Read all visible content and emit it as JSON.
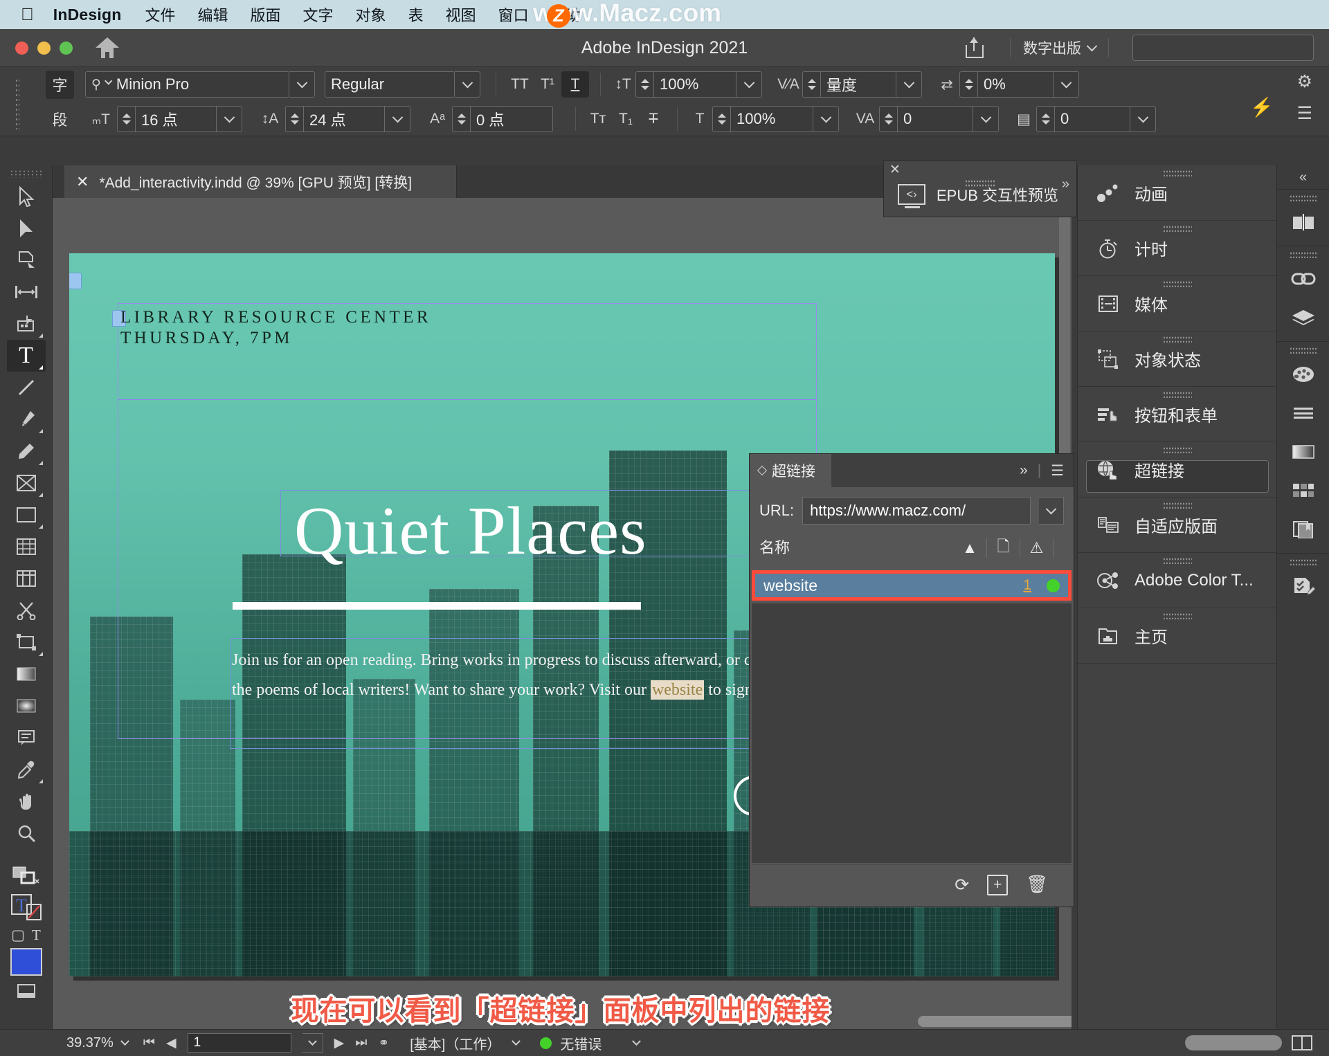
{
  "menubar": {
    "apple_icon": "apple-icon",
    "app_name": "InDesign",
    "items": [
      "文件",
      "编辑",
      "版面",
      "文字",
      "对象",
      "表",
      "视图",
      "窗口",
      "帮助"
    ],
    "watermark": "www.Macz.com",
    "watermark_badge": "Z"
  },
  "titlebar": {
    "title": "Adobe InDesign 2021",
    "home_icon": "home-icon",
    "share_icon": "share-icon",
    "publish_label": "数字出版",
    "search_placeholder": ""
  },
  "control_bar": {
    "char_mode_label": "字",
    "para_mode_label": "段",
    "font_family": "Minion Pro",
    "font_style": "Regular",
    "font_size": "16 点",
    "leading": "24 点",
    "baseline_shift": "0 点",
    "vertical_scale": "100%",
    "horizontal_scale": "100%",
    "kerning": "量度",
    "tracking": "0",
    "skew": "0%",
    "language_right": "0",
    "buttons": {
      "all_caps": "TT",
      "superscript": "T¹",
      "underline": "T",
      "small_caps": "Tᴛ",
      "subscript": "T₁",
      "strikethrough": "T"
    },
    "gear_icon": "gear-icon",
    "menu_icon": "hamburger-icon",
    "bolt_icon": "lightning-icon"
  },
  "toolbar": {
    "tools": [
      {
        "name": "selection-tool",
        "glyph": "▷"
      },
      {
        "name": "direct-selection-tool",
        "glyph": "◥"
      },
      {
        "name": "page-tool",
        "glyph": "page"
      },
      {
        "name": "gap-tool",
        "glyph": "|↔|"
      },
      {
        "name": "content-collector-tool",
        "glyph": "collect"
      },
      {
        "name": "type-tool",
        "glyph": "T",
        "selected": true
      },
      {
        "name": "line-tool",
        "glyph": "/"
      },
      {
        "name": "pen-tool",
        "glyph": "pen"
      },
      {
        "name": "pencil-tool",
        "glyph": "pencil"
      },
      {
        "name": "frame-tool",
        "glyph": "⊠"
      },
      {
        "name": "rectangle-tool",
        "glyph": "▭"
      },
      {
        "name": "free-transform-tool",
        "glyph": "grid"
      },
      {
        "name": "column-tool",
        "glyph": "cols"
      },
      {
        "name": "scissors-tool",
        "glyph": "✂"
      },
      {
        "name": "transform-tool",
        "glyph": "transform"
      },
      {
        "name": "gradient-swatch-tool",
        "glyph": "grad"
      },
      {
        "name": "gradient-feather-tool",
        "glyph": "feather"
      },
      {
        "name": "note-tool",
        "glyph": "note"
      },
      {
        "name": "eyedropper-tool",
        "glyph": "dropper"
      },
      {
        "name": "hand-tool",
        "glyph": "✋"
      },
      {
        "name": "zoom-tool",
        "glyph": "🔍"
      }
    ]
  },
  "document_tab": {
    "close_icon": "close-icon",
    "label": "*Add_interactivity.indd @ 39% [GPU 预览] [转换]"
  },
  "canvas": {
    "headline_line1": "LIBRARY RESOURCE CENTER",
    "headline_line2": "THURSDAY, 7PM",
    "big_title": "Quiet Places",
    "body_line1": "Join us for an open reading. Bring works in progress to discuss afterward, or co",
    "body_line2_a": "the poems of local writers! Want to share your work? Visit our ",
    "body_link": "website",
    "body_line2_b": " to sign u"
  },
  "epub_panel": {
    "close_icon": "close-icon",
    "icon": "code-monitor-icon",
    "label": "EPUB 交互性预览",
    "expand_icon": "double-chevron-right-icon"
  },
  "hyperlinks_panel": {
    "tab_label": "超链接",
    "expand_icon": "double-chevron-right-icon",
    "menu_icon": "panel-menu-icon",
    "url_label": "URL:",
    "url_value": "https://www.macz.com/",
    "column_name": "名称",
    "sort_icon": "sort-ascending-icon",
    "page_col_icon": "document-icon",
    "status_col_icon": "warning-icon",
    "rows": [
      {
        "name": "website",
        "page": "1",
        "status_color": "#44d22a"
      }
    ],
    "footer": {
      "refresh_icon": "refresh-icon",
      "new_icon": "new-hyperlink-icon",
      "delete_icon": "trash-icon"
    }
  },
  "right_panel": {
    "items": [
      {
        "label": "动画",
        "icon": "animation-icon",
        "selected": false
      },
      {
        "label": "计时",
        "icon": "timing-stopwatch-icon",
        "selected": false
      },
      {
        "label": "媒体",
        "icon": "media-film-icon",
        "selected": false
      },
      {
        "label": "对象状态",
        "icon": "object-states-icon",
        "selected": false
      },
      {
        "label": "按钮和表单",
        "icon": "buttons-forms-icon",
        "selected": false
      },
      {
        "label": "超链接",
        "icon": "hyperlinks-globe-icon",
        "selected": true
      },
      {
        "label": "自适应版面",
        "icon": "liquid-layout-icon",
        "selected": false
      },
      {
        "label": "Adobe Color T...",
        "icon": "adobe-color-themes-icon",
        "selected": false
      },
      {
        "label": "主页",
        "icon": "master-pages-icon",
        "selected": false
      }
    ]
  },
  "icon_dock": {
    "collapse_icon": "double-chevron-left-icon",
    "groups": [
      [
        "pages-spread-icon"
      ],
      [
        "links-chain-icon",
        "layers-icon"
      ],
      [
        "color-palette-icon",
        "stroke-lines-icon",
        "gradient-icon",
        "swatches-grid-icon",
        "libraries-icon"
      ],
      [
        "preflight-pencil-icon"
      ]
    ]
  },
  "annotation": {
    "text": "现在可以看到「超链接」面板中列出的链接",
    "color": "#f05a46"
  },
  "status_bar": {
    "zoom": "39.37%",
    "first_page_icon": "first-page-icon",
    "prev_page_icon": "prev-page-icon",
    "page_value": "1",
    "next_page_icon": "next-page-icon",
    "last_page_icon": "last-page-icon",
    "page_type_icon": "page-transition-icon",
    "workspace": "[基本]（工作）",
    "error_status": "无错误",
    "error_dot_color": "#44d22a",
    "view_toggle_icon": "view-mode-icon"
  }
}
